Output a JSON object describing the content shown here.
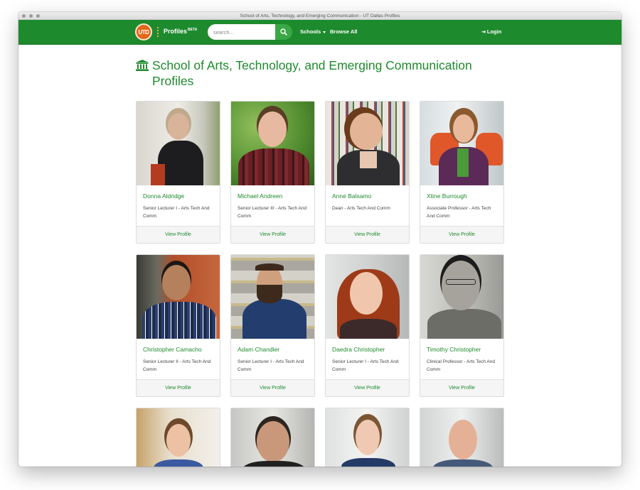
{
  "window": {
    "title": "School of Arts, Technology, and Emerging Communication - UT Dallas Profiles"
  },
  "navbar": {
    "logo_text": "UTD",
    "brand": "Profiles",
    "brand_badge": "BETA",
    "search_placeholder": "search...",
    "schools_label": "Schools",
    "browse_label": "Browse All",
    "login_label": "Login",
    "accent_color": "#1e8a2e"
  },
  "page": {
    "title": "School of Arts, Technology, and Emerging Communication Profiles",
    "view_profile_label": "View Profile"
  },
  "profiles": [
    {
      "name": "Donna Aldridge",
      "title": "Senior Lecturer I - Arts Tech And Comm"
    },
    {
      "name": "Michael Andreen",
      "title": "Senior Lecturer III - Arts Tech And Comm"
    },
    {
      "name": "Anne Balsamo",
      "title": "Dean - Arts Tech And Comm"
    },
    {
      "name": "Xtine Burrough",
      "title": "Associate Professor - Arts Tech And Comm"
    },
    {
      "name": "Christopher Camacho",
      "title": "Senior Lecturer II - Arts Tech And Comm"
    },
    {
      "name": "Adam Chandler",
      "title": "Senior Lecturer I - Arts Tech And Comm"
    },
    {
      "name": "Daedra Christopher",
      "title": "Senior Lecturer I - Arts Tech And Comm"
    },
    {
      "name": "Timothy Christopher",
      "title": "Clinical Professor - Arts Tech And Comm"
    }
  ]
}
